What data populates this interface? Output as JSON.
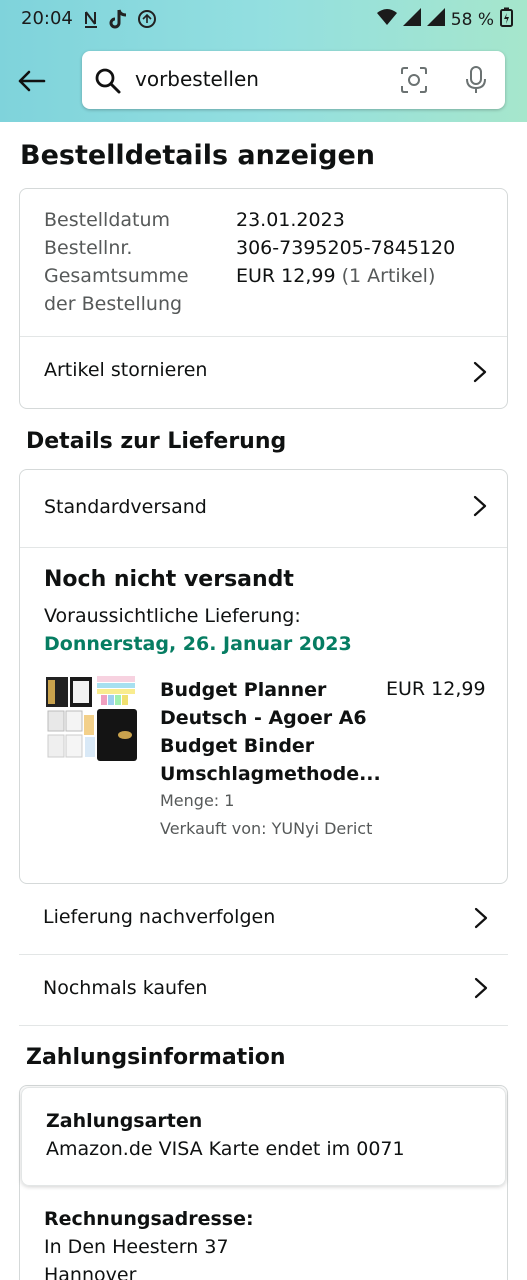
{
  "status_bar": {
    "time": "20:04",
    "battery": "58 %"
  },
  "search": {
    "query": "vorbestellen"
  },
  "page": {
    "title": "Bestelldetails anzeigen"
  },
  "order_summary": {
    "date_label": "Bestelldatum",
    "date_value": "23.01.2023",
    "number_label": "Bestellnr.",
    "number_value": "306-7395205-7845120",
    "total_label_1": "Gesamtsumme",
    "total_label_2": "der Bestellung",
    "total_value": "EUR 12,99",
    "total_items": "(1 Artikel)",
    "cancel_label": "Artikel stornieren"
  },
  "delivery": {
    "section_title": "Details zur Lieferung",
    "shipping_method": "Standardversand",
    "status": "Noch nicht versandt",
    "expected_label": "Voraussichtliche Lieferung:",
    "expected_date": "Donnerstag, 26. Januar 2023",
    "item": {
      "title_lines": [
        "Budget Planner",
        "Deutsch - Agoer A6",
        "Budget Binder",
        "Umschlagmethode..."
      ],
      "price": "EUR 12,99",
      "quantity": "Menge: 1",
      "seller": "Verkauft von: YUNyi Derict"
    },
    "track_label": "Lieferung nachverfolgen",
    "buy_again_label": "Nochmals kaufen"
  },
  "payment": {
    "section_title": "Zahlungsinformation",
    "methods_label": "Zahlungsarten",
    "card_name": "Amazon.de VISA Karte",
    "card_ending": "endet im 0071",
    "billing_label": "Rechnungsadresse:",
    "billing_street": "In Den Heestern 37",
    "billing_city": "Hannover"
  },
  "colors": {
    "accent_green": "#067d62",
    "header_gradient_start": "#7fd3db",
    "header_gradient_end": "#a6e6cc"
  }
}
